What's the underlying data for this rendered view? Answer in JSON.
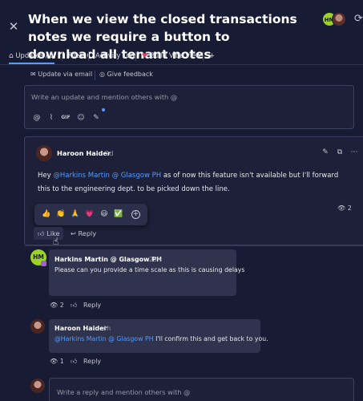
{
  "header": {
    "title": "When we view the closed transactions notes we require a button to download all tenant notes",
    "avatar_initials": "HM"
  },
  "tabs": [
    {
      "label": "Updates / 1"
    },
    {
      "label": "Files"
    },
    {
      "label": "Activity Log"
    },
    {
      "label": "Build Vibe view"
    },
    {
      "label": "+"
    }
  ],
  "sub_actions": {
    "update_via_email": "Update via email",
    "give_feedback": "Give feedback"
  },
  "editor": {
    "placeholder": "Write an update and mention others with @",
    "tools": [
      "at-icon",
      "attachment-icon",
      "gif-icon",
      "emoji-icon",
      "magic-icon"
    ],
    "gif_label": "GIF"
  },
  "post": {
    "author": "Haroon Haider",
    "time": "2d",
    "body_prefix": "Hey ",
    "mention": "@Harkins Martin @ Glasgow PH",
    "body_suffix": " as of now this feature isn't available but I'll forward this to the engineering dept. to be picked down the line.",
    "seen_count": "2",
    "like_label": "Like",
    "reply_label": "Reply",
    "reactions": [
      "👍",
      "👏",
      "🙏",
      "💗",
      "😃",
      "✅",
      "+"
    ]
  },
  "replies": [
    {
      "author": "Harkins Martin @ Glasgow PH",
      "time": "23h",
      "text": "Please can you provide a time scale as this is causing delays",
      "seen_count": "2",
      "reply_label": "Reply",
      "avatar_initials": "HM"
    },
    {
      "author": "Haroon Haider",
      "time": "4h",
      "mention": "@Harkins Martin @ Glasgow PH",
      "text": " I'll confirm this and get back to you.",
      "seen_count": "1",
      "reply_label": "Reply"
    }
  ],
  "reply_box": {
    "placeholder": "Write a reply and mention others with @"
  },
  "colors": {
    "background": "#181b34",
    "accent": "#579bfc",
    "avatar_green": "#9cd326",
    "bubble": "#30334e"
  }
}
